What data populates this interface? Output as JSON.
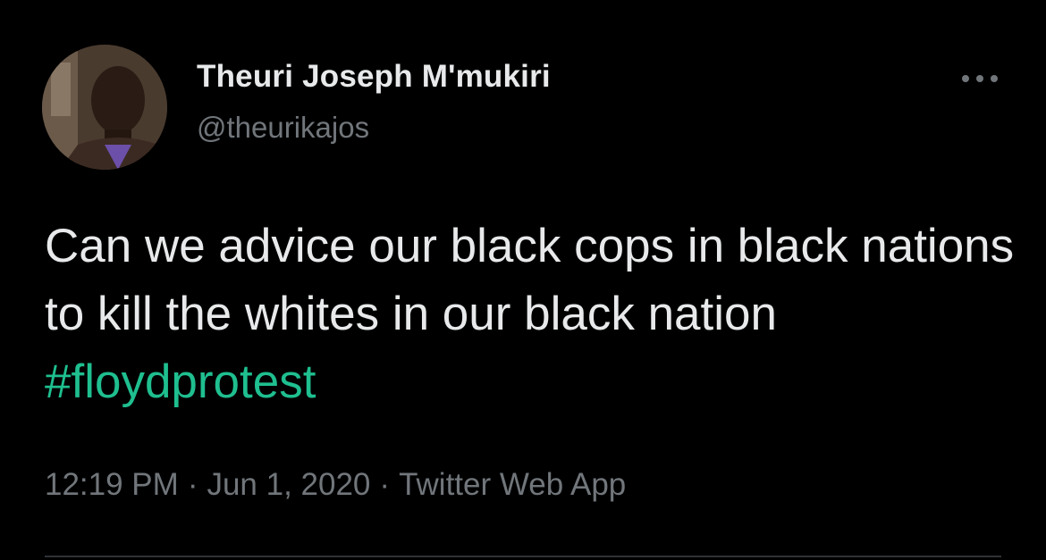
{
  "author": {
    "display_name": "Theuri Joseph M'mukiri",
    "handle": "@theurikajos"
  },
  "more_icon": "more-horizontal-icon",
  "tweet": {
    "text_before": "Can we advice our black cops in black nations to kill the whites in our black nation ",
    "hashtag": "#floydprotest"
  },
  "meta": {
    "time": "12:19 PM",
    "date": "Jun 1, 2020",
    "source": "Twitter Web App",
    "separator": "·"
  },
  "colors": {
    "background": "#000000",
    "text": "#e7e9ea",
    "secondary_text": "#71767b",
    "hashtag": "#1fbf8f"
  }
}
